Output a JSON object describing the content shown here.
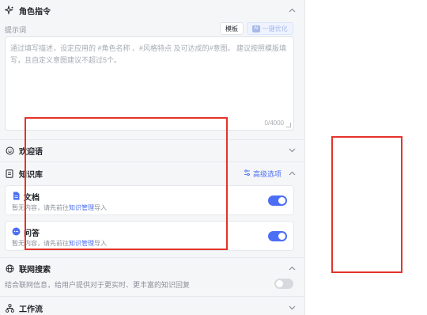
{
  "role_instruction": {
    "title": "角色指令",
    "prompt_label": "提示词",
    "template_button": "模板",
    "optimize_tag": "AI",
    "optimize_button": "一键优化",
    "placeholder": "通过填写描述，设定应用的 #角色名称 、#风格特点 及可达成的#意图。 建议按照模版填写，且自定义意图建议不超过5个。",
    "counter": "0/4000"
  },
  "welcome": {
    "title": "欢迎语"
  },
  "knowledge": {
    "title": "知识库",
    "advanced": "高级选项",
    "items": [
      {
        "title": "文档",
        "desc_prefix": "暂无内容，请先前往",
        "link": "知识管理",
        "desc_suffix": "导入",
        "enabled": true,
        "icon": "document-icon"
      },
      {
        "title": "问答",
        "desc_prefix": "暂无内容，请先前往",
        "link": "知识管理",
        "desc_suffix": "导入",
        "enabled": true,
        "icon": "qa-icon"
      }
    ]
  },
  "web_search": {
    "title": "联网搜索",
    "desc": "结合联网信息，给用户提供对于更实时、更丰富的知识回复",
    "enabled": false
  },
  "workflow": {
    "title": "工作流"
  },
  "colors": {
    "accent": "#4c6ef5",
    "annotation": "#e5332a"
  }
}
